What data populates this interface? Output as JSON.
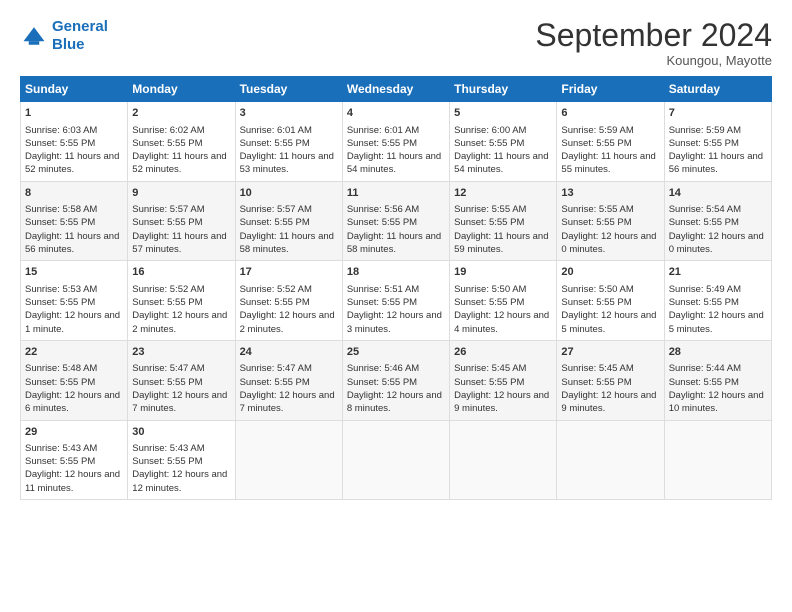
{
  "logo": {
    "line1": "General",
    "line2": "Blue"
  },
  "title": "September 2024",
  "location": "Koungou, Mayotte",
  "days_of_week": [
    "Sunday",
    "Monday",
    "Tuesday",
    "Wednesday",
    "Thursday",
    "Friday",
    "Saturday"
  ],
  "weeks": [
    [
      {
        "day": 1,
        "sunrise": "6:03 AM",
        "sunset": "5:55 PM",
        "daylight": "11 hours and 52 minutes."
      },
      {
        "day": 2,
        "sunrise": "6:02 AM",
        "sunset": "5:55 PM",
        "daylight": "11 hours and 52 minutes."
      },
      {
        "day": 3,
        "sunrise": "6:01 AM",
        "sunset": "5:55 PM",
        "daylight": "11 hours and 53 minutes."
      },
      {
        "day": 4,
        "sunrise": "6:01 AM",
        "sunset": "5:55 PM",
        "daylight": "11 hours and 54 minutes."
      },
      {
        "day": 5,
        "sunrise": "6:00 AM",
        "sunset": "5:55 PM",
        "daylight": "11 hours and 54 minutes."
      },
      {
        "day": 6,
        "sunrise": "5:59 AM",
        "sunset": "5:55 PM",
        "daylight": "11 hours and 55 minutes."
      },
      {
        "day": 7,
        "sunrise": "5:59 AM",
        "sunset": "5:55 PM",
        "daylight": "11 hours and 56 minutes."
      }
    ],
    [
      {
        "day": 8,
        "sunrise": "5:58 AM",
        "sunset": "5:55 PM",
        "daylight": "11 hours and 56 minutes."
      },
      {
        "day": 9,
        "sunrise": "5:57 AM",
        "sunset": "5:55 PM",
        "daylight": "11 hours and 57 minutes."
      },
      {
        "day": 10,
        "sunrise": "5:57 AM",
        "sunset": "5:55 PM",
        "daylight": "11 hours and 58 minutes."
      },
      {
        "day": 11,
        "sunrise": "5:56 AM",
        "sunset": "5:55 PM",
        "daylight": "11 hours and 58 minutes."
      },
      {
        "day": 12,
        "sunrise": "5:55 AM",
        "sunset": "5:55 PM",
        "daylight": "11 hours and 59 minutes."
      },
      {
        "day": 13,
        "sunrise": "5:55 AM",
        "sunset": "5:55 PM",
        "daylight": "12 hours and 0 minutes."
      },
      {
        "day": 14,
        "sunrise": "5:54 AM",
        "sunset": "5:55 PM",
        "daylight": "12 hours and 0 minutes."
      }
    ],
    [
      {
        "day": 15,
        "sunrise": "5:53 AM",
        "sunset": "5:55 PM",
        "daylight": "12 hours and 1 minute."
      },
      {
        "day": 16,
        "sunrise": "5:52 AM",
        "sunset": "5:55 PM",
        "daylight": "12 hours and 2 minutes."
      },
      {
        "day": 17,
        "sunrise": "5:52 AM",
        "sunset": "5:55 PM",
        "daylight": "12 hours and 2 minutes."
      },
      {
        "day": 18,
        "sunrise": "5:51 AM",
        "sunset": "5:55 PM",
        "daylight": "12 hours and 3 minutes."
      },
      {
        "day": 19,
        "sunrise": "5:50 AM",
        "sunset": "5:55 PM",
        "daylight": "12 hours and 4 minutes."
      },
      {
        "day": 20,
        "sunrise": "5:50 AM",
        "sunset": "5:55 PM",
        "daylight": "12 hours and 5 minutes."
      },
      {
        "day": 21,
        "sunrise": "5:49 AM",
        "sunset": "5:55 PM",
        "daylight": "12 hours and 5 minutes."
      }
    ],
    [
      {
        "day": 22,
        "sunrise": "5:48 AM",
        "sunset": "5:55 PM",
        "daylight": "12 hours and 6 minutes."
      },
      {
        "day": 23,
        "sunrise": "5:47 AM",
        "sunset": "5:55 PM",
        "daylight": "12 hours and 7 minutes."
      },
      {
        "day": 24,
        "sunrise": "5:47 AM",
        "sunset": "5:55 PM",
        "daylight": "12 hours and 7 minutes."
      },
      {
        "day": 25,
        "sunrise": "5:46 AM",
        "sunset": "5:55 PM",
        "daylight": "12 hours and 8 minutes."
      },
      {
        "day": 26,
        "sunrise": "5:45 AM",
        "sunset": "5:55 PM",
        "daylight": "12 hours and 9 minutes."
      },
      {
        "day": 27,
        "sunrise": "5:45 AM",
        "sunset": "5:55 PM",
        "daylight": "12 hours and 9 minutes."
      },
      {
        "day": 28,
        "sunrise": "5:44 AM",
        "sunset": "5:55 PM",
        "daylight": "12 hours and 10 minutes."
      }
    ],
    [
      {
        "day": 29,
        "sunrise": "5:43 AM",
        "sunset": "5:55 PM",
        "daylight": "12 hours and 11 minutes."
      },
      {
        "day": 30,
        "sunrise": "5:43 AM",
        "sunset": "5:55 PM",
        "daylight": "12 hours and 12 minutes."
      },
      null,
      null,
      null,
      null,
      null
    ]
  ]
}
